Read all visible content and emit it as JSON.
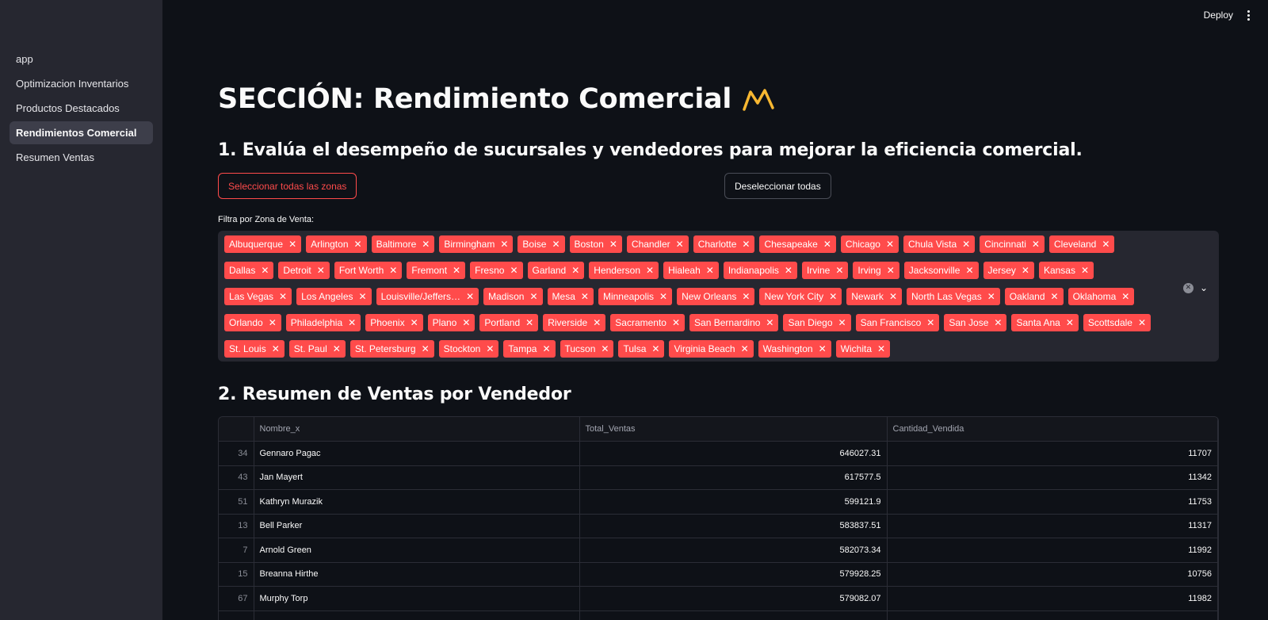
{
  "sidebar": {
    "items": [
      {
        "label": "app"
      },
      {
        "label": "Optimizacion Inventarios"
      },
      {
        "label": "Productos Destacados"
      },
      {
        "label": "Rendimientos Comercial"
      },
      {
        "label": "Resumen Ventas"
      }
    ],
    "active_index": 3
  },
  "header": {
    "deploy_label": "Deploy",
    "menu_icon": "kebab-vertical-icon"
  },
  "page": {
    "title": "SECCIÓN: Rendimiento Comercial",
    "title_icon": "chart-trend-icon",
    "section1_title": "1. Evalúa el desempeño de sucursales y vendedores para mejorar la eficiencia comercial.",
    "select_all_label": "Seleccionar todas las zonas",
    "deselect_all_label": "Deseleccionar todas",
    "filter_label": "Filtra por Zona de Venta:",
    "section2_title": "2. Resumen de Ventas por Vendedor"
  },
  "zones": [
    "Albuquerque",
    "Arlington",
    "Baltimore",
    "Birmingham",
    "Boise",
    "Boston",
    "Chandler",
    "Charlotte",
    "Chesapeake",
    "Chicago",
    "Chula Vista",
    "Cincinnati",
    "Cleveland",
    "Dallas",
    "Detroit",
    "Fort Worth",
    "Fremont",
    "Fresno",
    "Garland",
    "Henderson",
    "Hialeah",
    "Indianapolis",
    "Irvine",
    "Irving",
    "Jacksonville",
    "Jersey",
    "Kansas",
    "Las Vegas",
    "Los Angeles",
    "Louisville/Jeffers…",
    "Madison",
    "Mesa",
    "Minneapolis",
    "New Orleans",
    "New York City",
    "Newark",
    "North Las Vegas",
    "Oakland",
    "Oklahoma",
    "Orlando",
    "Philadelphia",
    "Phoenix",
    "Plano",
    "Portland",
    "Riverside",
    "Sacramento",
    "San Bernardino",
    "San Diego",
    "San Francisco",
    "San Jose",
    "Santa Ana",
    "Scottsdale",
    "St. Louis",
    "St. Paul",
    "St. Petersburg",
    "Stockton",
    "Tampa",
    "Tucson",
    "Tulsa",
    "Virginia Beach",
    "Washington",
    "Wichita"
  ],
  "colors": {
    "accent": "#ff4b4b",
    "background": "#0e1117",
    "sidebar": "#262730"
  },
  "table": {
    "columns": [
      "",
      "Nombre_x",
      "Total_Ventas",
      "Cantidad_Vendida"
    ],
    "rows": [
      [
        "34",
        "Gennaro Pagac",
        "646027.31",
        "11707"
      ],
      [
        "43",
        "Jan Mayert",
        "617577.5",
        "11342"
      ],
      [
        "51",
        "Kathryn Murazik",
        "599121.9",
        "11753"
      ],
      [
        "13",
        "Bell Parker",
        "583837.51",
        "11317"
      ],
      [
        "7",
        "Arnold Green",
        "582073.34",
        "11992"
      ],
      [
        "15",
        "Breanna Hirthe",
        "579928.25",
        "10756"
      ],
      [
        "67",
        "Murphy Torp",
        "579082.07",
        "11982"
      ],
      [
        "",
        "",
        "",
        ""
      ]
    ]
  }
}
